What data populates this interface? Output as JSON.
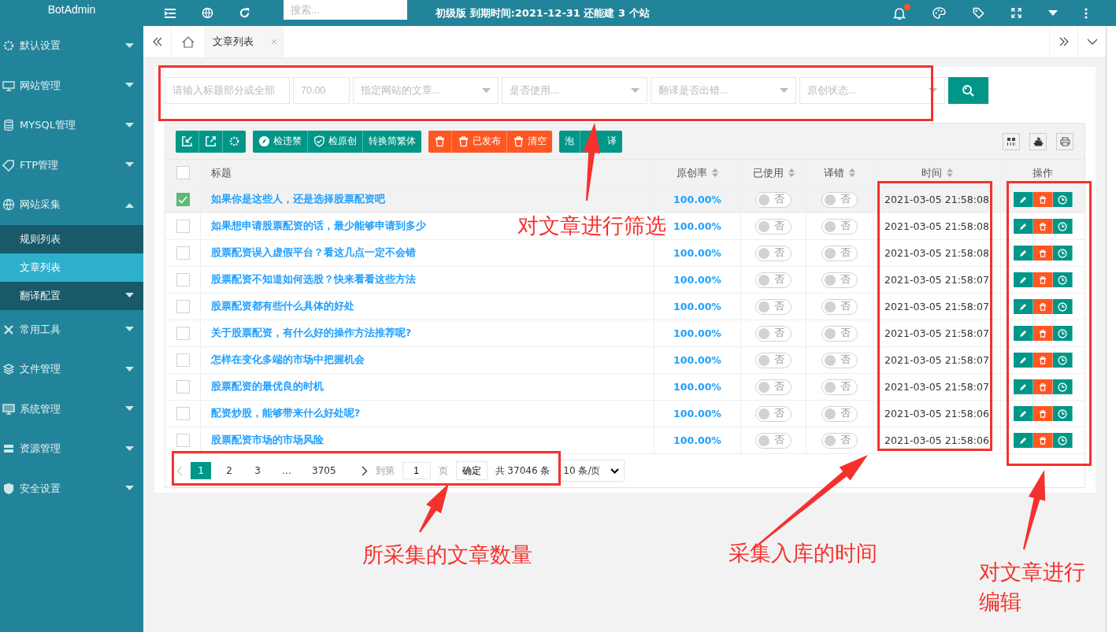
{
  "header": {
    "brand": "BotAdmin",
    "search_placeholder": "搜索...",
    "notice": "初级版 到期时间:2021-12-31 还能建 3 个站",
    "has_notification": true
  },
  "sidebar": {
    "items": [
      {
        "label": "默认设置",
        "expanded": false
      },
      {
        "label": "网站管理",
        "expanded": false
      },
      {
        "label": "MYSQL管理",
        "expanded": false
      },
      {
        "label": "FTP管理",
        "expanded": false
      },
      {
        "label": "网站采集",
        "expanded": true,
        "children": [
          {
            "label": "规则列表",
            "selected": false
          },
          {
            "label": "文章列表",
            "selected": true
          },
          {
            "label": "翻译配置",
            "selected": false,
            "expanded": false
          }
        ]
      },
      {
        "label": "常用工具",
        "expanded": false
      },
      {
        "label": "文件管理",
        "expanded": false
      },
      {
        "label": "系统管理",
        "expanded": false
      },
      {
        "label": "资源管理",
        "expanded": false
      },
      {
        "label": "安全设置",
        "expanded": false
      }
    ]
  },
  "tabs": [
    {
      "label": "文章列表"
    }
  ],
  "filters": [
    {
      "kind": "input",
      "placeholder": "请输入标题部分或全部"
    },
    {
      "kind": "input",
      "placeholder": "70.00"
    },
    {
      "kind": "select",
      "placeholder": "指定网站的文章..."
    },
    {
      "kind": "select",
      "placeholder": "是否使用..."
    },
    {
      "kind": "select",
      "placeholder": "翻译是否出错..."
    },
    {
      "kind": "select",
      "placeholder": "原创状态..."
    }
  ],
  "toolbar": [
    {
      "color": "#009688"
    },
    {
      "color": "#009688",
      "labels": [
        "检违禁",
        "检原创",
        "转换简繁体"
      ]
    },
    {
      "color": "#ff5722",
      "labels": [
        "已发布",
        "清空"
      ]
    },
    {
      "color": "#009688",
      "labels": [
        "泡",
        "译"
      ]
    }
  ],
  "table": {
    "all_checked": false,
    "columns": [
      {
        "label": "标题",
        "sortable": false
      },
      {
        "label": "原创率",
        "sortable": true
      },
      {
        "label": "已使用",
        "sortable": true
      },
      {
        "label": "译错",
        "sortable": true
      },
      {
        "label": "时间",
        "sortable": true
      },
      {
        "label": "操作",
        "sortable": false
      }
    ],
    "rows": [
      {
        "checked": true,
        "title": "如果你是这些人，还是选择股票配资吧",
        "rate": "100.00%",
        "used": false,
        "used_text": "否",
        "error": false,
        "error_text": "否",
        "time": "2021-03-05 21:58:08"
      },
      {
        "checked": false,
        "title": "如果想申请股票配资的话，最少能够申请到多少",
        "rate": "100.00%",
        "used": false,
        "used_text": "否",
        "error": false,
        "error_text": "否",
        "time": "2021-03-05 21:58:08"
      },
      {
        "checked": false,
        "title": "股票配资误入虚假平台？看这几点一定不会错",
        "rate": "100.00%",
        "used": false,
        "used_text": "否",
        "error": false,
        "error_text": "否",
        "time": "2021-03-05 21:58:08"
      },
      {
        "checked": false,
        "title": "股票配资不知道如何选股？快来看看这些方法",
        "rate": "100.00%",
        "used": false,
        "used_text": "否",
        "error": false,
        "error_text": "否",
        "time": "2021-03-05 21:58:07"
      },
      {
        "checked": false,
        "title": "股票配资都有些什么具体的好处",
        "rate": "100.00%",
        "used": false,
        "used_text": "否",
        "error": false,
        "error_text": "否",
        "time": "2021-03-05 21:58:07"
      },
      {
        "checked": false,
        "title": "关于股票配资，有什么好的操作方法推荐呢?",
        "rate": "100.00%",
        "used": false,
        "used_text": "否",
        "error": false,
        "error_text": "否",
        "time": "2021-03-05 21:58:07"
      },
      {
        "checked": false,
        "title": "怎样在变化多端的市场中把握机会",
        "rate": "100.00%",
        "used": false,
        "used_text": "否",
        "error": false,
        "error_text": "否",
        "time": "2021-03-05 21:58:07"
      },
      {
        "checked": false,
        "title": "股票配资的最优良的时机",
        "rate": "100.00%",
        "used": false,
        "used_text": "否",
        "error": false,
        "error_text": "否",
        "time": "2021-03-05 21:58:07"
      },
      {
        "checked": false,
        "title": "配资炒股，能够带来什么好处呢?",
        "rate": "100.00%",
        "used": false,
        "used_text": "否",
        "error": false,
        "error_text": "否",
        "time": "2021-03-05 21:58:06"
      },
      {
        "checked": false,
        "title": "股票配资市场的市场风险",
        "rate": "100.00%",
        "used": false,
        "used_text": "否",
        "error": false,
        "error_text": "否",
        "time": "2021-03-05 21:58:06"
      }
    ]
  },
  "pagination": {
    "pages": [
      {
        "label": "1",
        "selected": true
      },
      {
        "label": "2",
        "selected": false
      },
      {
        "label": "3",
        "selected": false
      },
      {
        "label": "…",
        "selected": false
      },
      {
        "label": "3705",
        "selected": false
      }
    ],
    "goto_label": "到第",
    "goto_value": "1",
    "page_unit": "页",
    "confirm": "确定",
    "total": "共 37046 条",
    "page_size": "10 条/页"
  },
  "annotations": [
    {
      "text": "对文章进行筛选"
    },
    {
      "text": "所采集的文章数量"
    },
    {
      "text": "采集入库的时间"
    },
    {
      "text": "对文章进行编辑"
    }
  ]
}
